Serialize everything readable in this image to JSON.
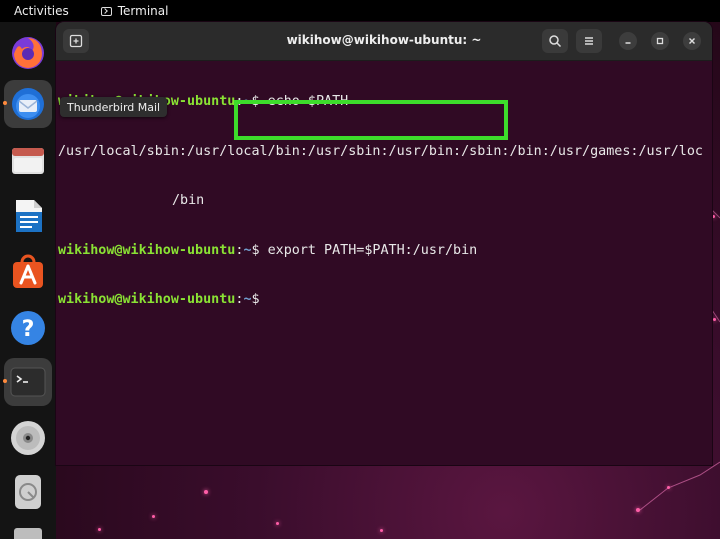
{
  "topbar": {
    "activities": "Activities",
    "app_name": "Terminal"
  },
  "dock": {
    "items": [
      {
        "name": "Firefox",
        "icon": "firefox-icon"
      },
      {
        "name": "Thunderbird Mail",
        "icon": "thunderbird-icon"
      },
      {
        "name": "Files",
        "icon": "files-icon"
      },
      {
        "name": "LibreOffice Writer",
        "icon": "writer-icon"
      },
      {
        "name": "Ubuntu Software",
        "icon": "software-icon"
      },
      {
        "name": "Help",
        "icon": "help-icon"
      },
      {
        "name": "Terminal",
        "icon": "terminal-icon"
      },
      {
        "name": "Disc",
        "icon": "disc-icon"
      },
      {
        "name": "Drive",
        "icon": "drive-icon"
      }
    ],
    "tooltip": "Thunderbird Mail"
  },
  "terminal": {
    "title": "wikihow@wikihow-ubuntu: ~",
    "prompt_user": "wikihow@wikihow-ubuntu",
    "prompt_path": "~",
    "lines": {
      "l1_cmd": "$ echo $PATH",
      "l2": "/usr/local/sbin:/usr/local/bin:/usr/sbin:/usr/bin:/sbin:/bin:/usr/games:/usr/loc",
      "l3": "/bin",
      "l4_cmd": "$ export PATH=$PATH:/usr/bin",
      "l5_cmd": "$"
    }
  },
  "colors": {
    "terminal_bg": "#300a24",
    "prompt_user": "#8ae234",
    "prompt_path": "#729fcf",
    "highlight": "#3ddc2b"
  }
}
